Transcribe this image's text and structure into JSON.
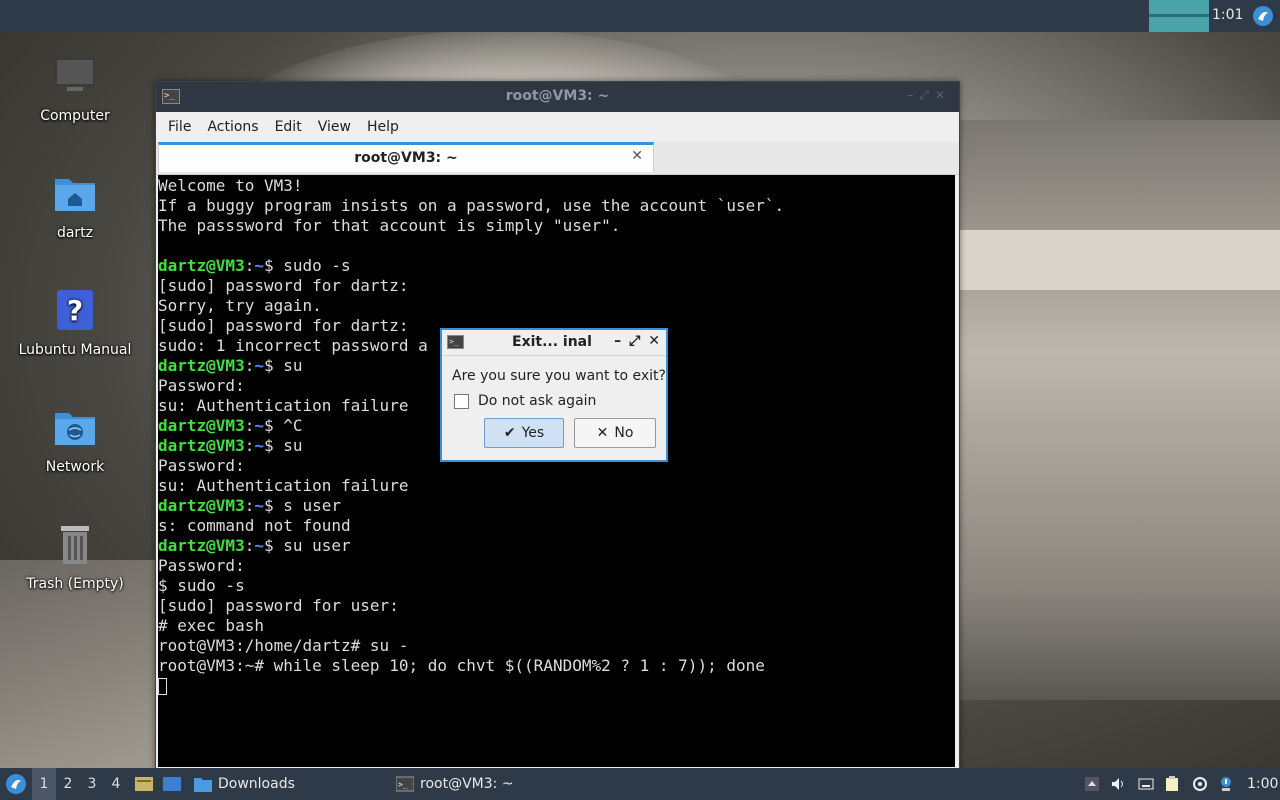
{
  "top_panel": {
    "clock": "1:01"
  },
  "desktop": {
    "icons": [
      {
        "label": "Computer"
      },
      {
        "label": "dartz"
      },
      {
        "label": "Lubuntu Manual"
      },
      {
        "label": "Network"
      },
      {
        "label": "Trash (Empty)"
      }
    ]
  },
  "terminal_window": {
    "title": "root@VM3: ~",
    "menu": [
      "File",
      "Actions",
      "Edit",
      "View",
      "Help"
    ],
    "tab_title": "root@VM3: ~",
    "lines": [
      {
        "text": "Welcome to VM3!"
      },
      {
        "text": "If a buggy program insists on a password, use the account `user`."
      },
      {
        "text": "The passsword for that account is simply \"user\"."
      },
      {
        "text": ""
      },
      {
        "user": "dartz@VM3",
        "path": "~",
        "cmd": "$ sudo -s"
      },
      {
        "text": "[sudo] password for dartz:"
      },
      {
        "text": "Sorry, try again."
      },
      {
        "text": "[sudo] password for dartz:"
      },
      {
        "text": "sudo: 1 incorrect password a"
      },
      {
        "user": "dartz@VM3",
        "path": "~",
        "cmd": "$ su"
      },
      {
        "text": "Password:"
      },
      {
        "text": "su: Authentication failure"
      },
      {
        "user": "dartz@VM3",
        "path": "~",
        "cmd": "$ ^C"
      },
      {
        "user": "dartz@VM3",
        "path": "~",
        "cmd": "$ su"
      },
      {
        "text": "Password:"
      },
      {
        "text": "su: Authentication failure"
      },
      {
        "user": "dartz@VM3",
        "path": "~",
        "cmd": "$ s user"
      },
      {
        "text": "s: command not found"
      },
      {
        "user": "dartz@VM3",
        "path": "~",
        "cmd": "$ su user"
      },
      {
        "text": "Password:"
      },
      {
        "text": "$ sudo -s"
      },
      {
        "text": "[sudo] password for user:"
      },
      {
        "text": "# exec bash"
      },
      {
        "text": "root@VM3:/home/dartz# su -"
      },
      {
        "text": "root@VM3:~# while sleep 10; do chvt $((RANDOM%2 ? 1 : 7)); done"
      }
    ]
  },
  "dialog": {
    "title": "Exit...  inal",
    "question": "Are you sure you want to exit?",
    "checkbox_label": "Do not ask again",
    "yes_label": "Yes",
    "no_label": "No"
  },
  "bottom_panel": {
    "workspaces": [
      "1",
      "2",
      "3",
      "4"
    ],
    "tasks": [
      {
        "label": "Downloads",
        "icon": "folder-icon"
      },
      {
        "label": "root@VM3: ~",
        "icon": "terminal-icon"
      }
    ],
    "clock": "1:00"
  }
}
